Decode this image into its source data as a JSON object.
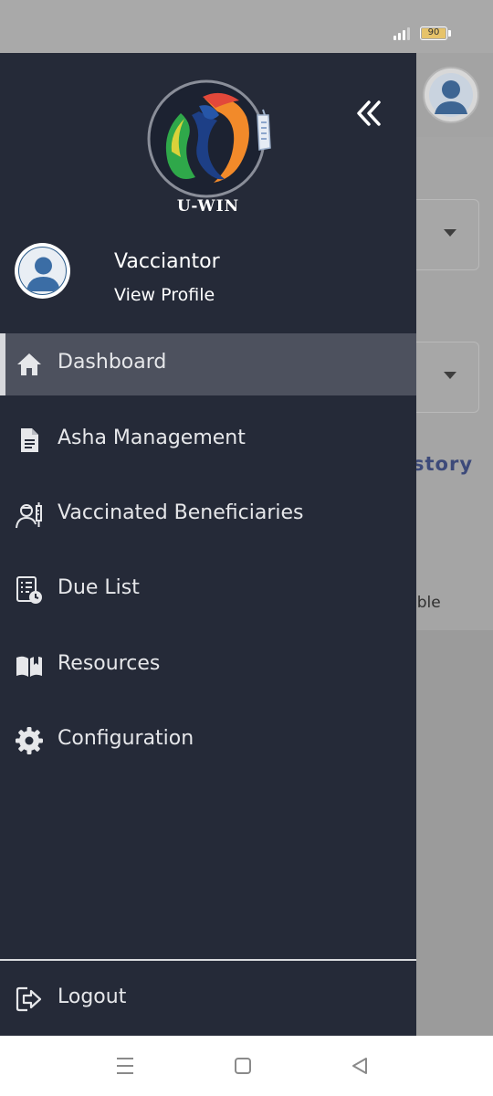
{
  "status_bar": {
    "battery_level": "90",
    "battery_color": "#e6c36a"
  },
  "drawer": {
    "logo_text": "U-WIN",
    "collapse_icon": "double-chevron-left-icon",
    "profile": {
      "name": "Vacciantor",
      "link": "View Profile"
    },
    "menu": [
      {
        "label": "Dashboard",
        "icon": "home-icon",
        "active": true
      },
      {
        "label": "Asha Management",
        "icon": "document-icon",
        "active": false
      },
      {
        "label": "Vaccinated Beneficiaries",
        "icon": "nurse-syringe-icon",
        "active": false
      },
      {
        "label": "Due List",
        "icon": "checklist-clock-icon",
        "active": false
      },
      {
        "label": "Resources",
        "icon": "open-book-icon",
        "active": false
      },
      {
        "label": "Configuration",
        "icon": "gear-icon",
        "active": false
      }
    ],
    "logout": {
      "label": "Logout",
      "icon": "logout-icon"
    }
  },
  "background_app": {
    "history_text": "story",
    "eligible_text": "ible"
  },
  "colors": {
    "drawer_bg": "#252a38",
    "active_item_bg": "#4d515e",
    "history_accent": "#3d4a7a"
  }
}
